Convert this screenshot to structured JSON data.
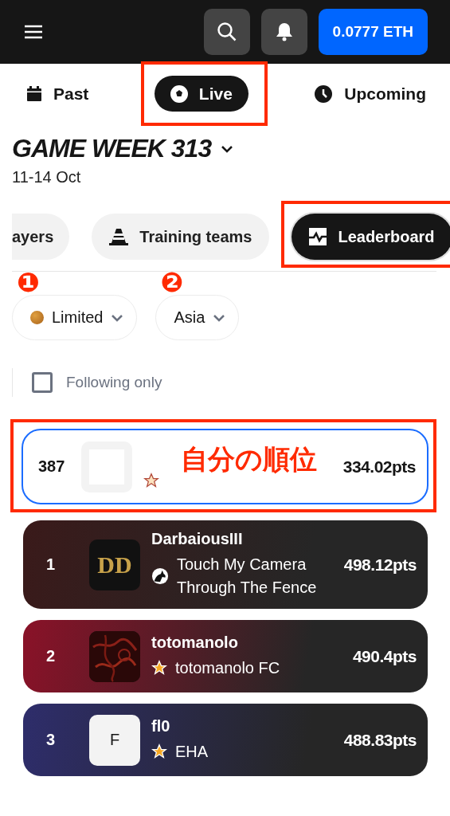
{
  "header": {
    "wallet": "0.0777 ETH"
  },
  "tabs": [
    {
      "label": "Past",
      "selected": false
    },
    {
      "label": "Live",
      "selected": true
    },
    {
      "label": "Upcoming",
      "selected": false
    }
  ],
  "game_week": {
    "title": "GAME WEEK 313",
    "dates": "11-14 Oct"
  },
  "sections": [
    {
      "label": "ayers",
      "selected": false
    },
    {
      "label": "Training teams",
      "selected": false
    },
    {
      "label": "Leaderboard",
      "selected": true
    }
  ],
  "filters": [
    {
      "label": "Limited",
      "marker": "❶",
      "dot": true
    },
    {
      "label": "Asia",
      "marker": "❷",
      "dot": false
    }
  ],
  "following_only": {
    "label": "Following only",
    "checked": false
  },
  "my_rank": {
    "rank": "387",
    "callout": "自分の順位",
    "points": "334.02pts"
  },
  "leaderboard": [
    {
      "rank": "1",
      "name": "DarbaiousIII",
      "club": "Touch My Camera Through The Fence",
      "avatar": {
        "kind": "logo",
        "text": "DD"
      },
      "points": "498.12pts",
      "color": "#3a1a1a"
    },
    {
      "rank": "2",
      "name": "totomanolo",
      "club": "totomanolo FC",
      "points": "490.4pts",
      "color": "#8a1228"
    },
    {
      "rank": "3",
      "name": "fl0",
      "club": "EHA",
      "avatar": {
        "kind": "letter",
        "text": "F"
      },
      "points": "488.83pts",
      "color": "#2e2d6b"
    }
  ]
}
